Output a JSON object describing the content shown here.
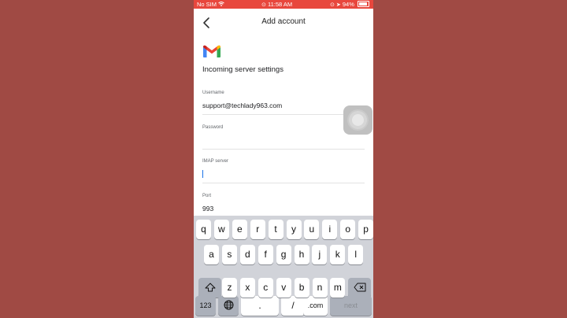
{
  "status_bar": {
    "carrier": "No SIM",
    "time": "11:58 AM",
    "battery_percent": "94%",
    "battery_level": 0.94
  },
  "header": {
    "title": "Add account",
    "back_icon": "chevron-left-icon"
  },
  "brand": {
    "logo": "gmail-logo",
    "colors": {
      "red": "#ea4335",
      "blue": "#4285f4",
      "green": "#34a853",
      "yellow": "#fbbc04"
    }
  },
  "page": {
    "heading": "Incoming server settings"
  },
  "fields": {
    "username": {
      "label": "Username",
      "value": "support@techlady963.com"
    },
    "password": {
      "label": "Password",
      "value": ""
    },
    "imap_server": {
      "label": "IMAP server",
      "value": ""
    },
    "port": {
      "label": "Port",
      "value": "993"
    }
  },
  "keyboard": {
    "row1": [
      "q",
      "w",
      "e",
      "r",
      "t",
      "y",
      "u",
      "i",
      "o",
      "p"
    ],
    "row2": [
      "a",
      "s",
      "d",
      "f",
      "g",
      "h",
      "j",
      "k",
      "l"
    ],
    "row3": [
      "z",
      "x",
      "c",
      "v",
      "b",
      "n",
      "m"
    ],
    "shift_icon": "shift-icon",
    "delete_icon": "backspace-icon",
    "globe_icon": "globe-icon",
    "numbers_label": "123",
    "dot_label": ".",
    "slash_label": "/",
    "dotcom_label": ".com",
    "next_label": "next"
  },
  "colors": {
    "status_bar": "#e8473d",
    "background": "#a04a44",
    "keyboard": "#d1d3d9",
    "cursor": "#1a73e8"
  }
}
